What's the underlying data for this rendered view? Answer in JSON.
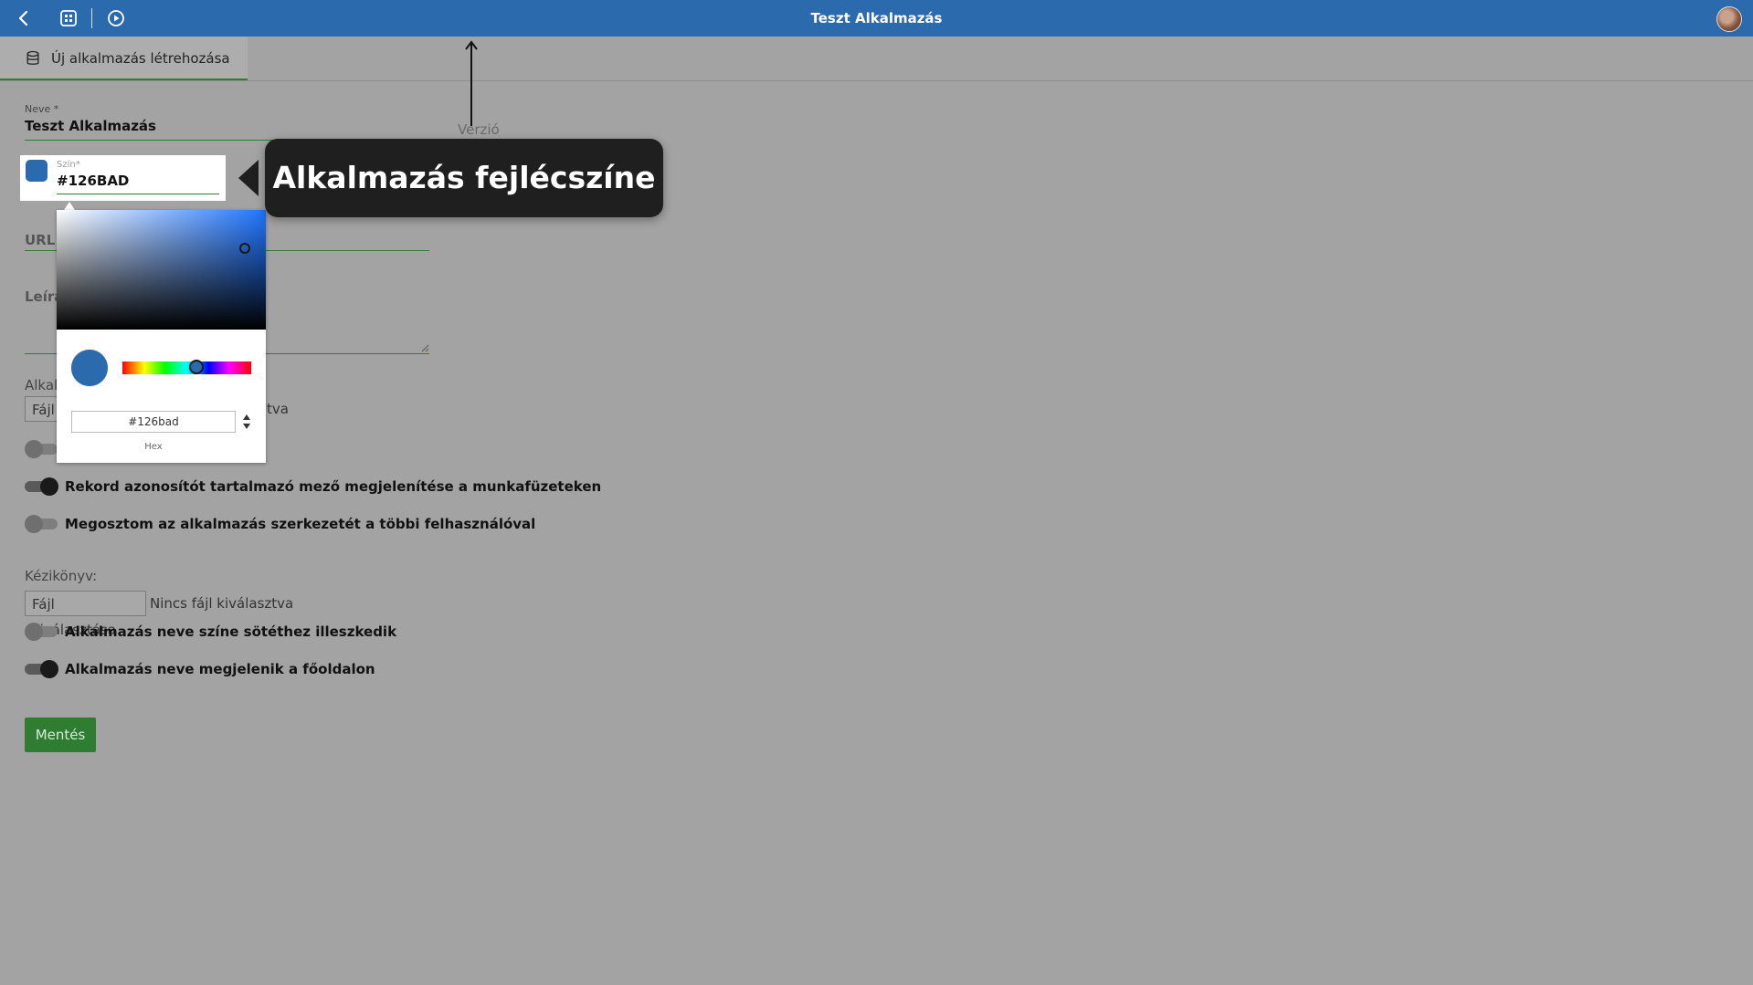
{
  "app": {
    "title": "Teszt Alkalmazás"
  },
  "tab": {
    "label": "Új alkalmazás létrehozása"
  },
  "form": {
    "name_label": "Neve *",
    "name_value": "Teszt Alkalmazás",
    "version_label": "Verzió",
    "color_label": "Szín*",
    "color_value": "#126BAD",
    "url_label_partial": "URL",
    "description_label_partial": "Leírá",
    "app_file_label_partial": "Alkal",
    "app_file_button_partial": "Fájl",
    "app_file_none_partial": "tva",
    "toggles": [
      {
        "label": "Rekord azonosítót tartalmazó mező megjelenítése a munkafüzeteken",
        "on": true
      },
      {
        "label": "Megosztom az alkalmazás szerkezetét a többi felhasználóval",
        "on": false
      }
    ],
    "manual_label": "Kézikönyv:",
    "manual_button": "Fájl kiválasztása",
    "manual_none": "Nincs fájl kiválasztva",
    "toggles2": [
      {
        "label": "Alkalmazás neve színe sötéthez illeszkedik",
        "on": false
      },
      {
        "label": "Alkalmazás neve megjelenik a főoldalon",
        "on": true
      }
    ],
    "save_button": "Mentés"
  },
  "picker": {
    "hex_value": "#126bad",
    "hex_label": "Hex",
    "selected_color": "#2c6aae"
  },
  "callout": {
    "text": "Alkalmazás fejlécszíne"
  },
  "icons": [
    "back-icon",
    "apps-grid-icon",
    "play-circle-icon",
    "database-icon",
    "user-avatar"
  ]
}
